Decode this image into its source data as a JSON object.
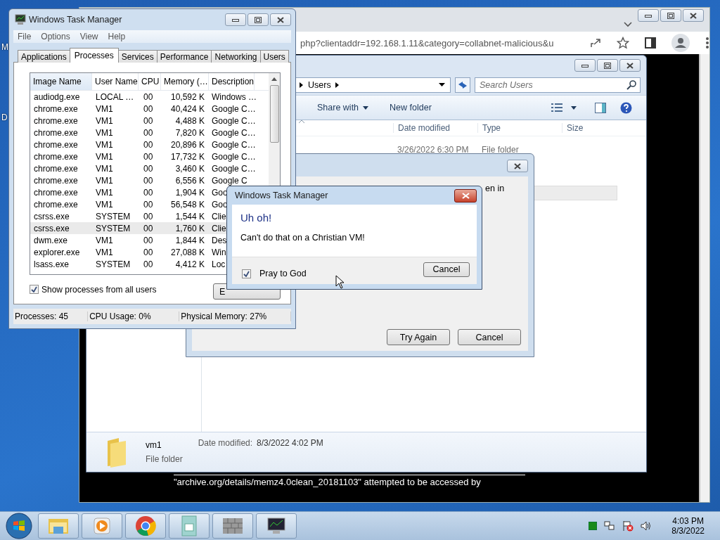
{
  "desktop": {
    "icon_labels": [
      "M",
      "D"
    ]
  },
  "browser": {
    "url": "php?clientaddr=192.168.1.11&category=collabnet-malicious&u",
    "page_text": "\"archive.org/details/memz4.0clean_20181103\" attempted to be accessed by"
  },
  "explorer": {
    "breadcrumb": "Users",
    "search": {
      "placeholder": "Search Users"
    },
    "toolbar": [
      "Share with",
      "New folder"
    ],
    "columns": [
      "Date modified",
      "Type",
      "Size"
    ],
    "rows": [
      {
        "date": "3/26/2022 6:30 PM",
        "type": "File folder"
      }
    ],
    "details": {
      "name": "vm1",
      "type": "File folder",
      "date_label": "Date modified:",
      "date": "8/3/2022 4:02 PM"
    }
  },
  "error_dialog": {
    "text": "en in",
    "buttons": [
      "Try Again",
      "Cancel"
    ]
  },
  "task_manager": {
    "title": "Windows Task Manager",
    "menu": [
      "File",
      "Options",
      "View",
      "Help"
    ],
    "tabs": [
      {
        "label": "Applications",
        "selected": false
      },
      {
        "label": "Processes",
        "selected": true
      },
      {
        "label": "Services",
        "selected": false
      },
      {
        "label": "Performance",
        "selected": false
      },
      {
        "label": "Networking",
        "selected": false
      },
      {
        "label": "Users",
        "selected": false
      }
    ],
    "columns": [
      "Image Name",
      "User Name",
      "CPU",
      "Memory (…",
      "Description"
    ],
    "rows": [
      {
        "cells": [
          "audiodg.exe",
          "LOCAL …",
          "00",
          "10,592 K",
          "Windows …"
        ],
        "selected": false
      },
      {
        "cells": [
          "chrome.exe",
          "VM1",
          "00",
          "40,424 K",
          "Google C…"
        ],
        "selected": false
      },
      {
        "cells": [
          "chrome.exe",
          "VM1",
          "00",
          "4,488 K",
          "Google C…"
        ],
        "selected": false
      },
      {
        "cells": [
          "chrome.exe",
          "VM1",
          "00",
          "7,820 K",
          "Google C…"
        ],
        "selected": false
      },
      {
        "cells": [
          "chrome.exe",
          "VM1",
          "00",
          "20,896 K",
          "Google C…"
        ],
        "selected": false
      },
      {
        "cells": [
          "chrome.exe",
          "VM1",
          "00",
          "17,732 K",
          "Google C…"
        ],
        "selected": false
      },
      {
        "cells": [
          "chrome.exe",
          "VM1",
          "00",
          "3,460 K",
          "Google C…"
        ],
        "selected": false
      },
      {
        "cells": [
          "chrome.exe",
          "VM1",
          "00",
          "6,556 K",
          "Google C"
        ],
        "selected": false
      },
      {
        "cells": [
          "chrome.exe",
          "VM1",
          "00",
          "1,904 K",
          "Goo"
        ],
        "selected": false
      },
      {
        "cells": [
          "chrome.exe",
          "VM1",
          "00",
          "56,548 K",
          "Goo"
        ],
        "selected": false
      },
      {
        "cells": [
          "csrss.exe",
          "SYSTEM",
          "00",
          "1,544 K",
          "Clie"
        ],
        "selected": false
      },
      {
        "cells": [
          "csrss.exe",
          "SYSTEM",
          "00",
          "1,760 K",
          "Clie"
        ],
        "selected": true
      },
      {
        "cells": [
          "dwm.exe",
          "VM1",
          "00",
          "1,844 K",
          "Des"
        ],
        "selected": false
      },
      {
        "cells": [
          "explorer.exe",
          "VM1",
          "00",
          "27,088 K",
          "Win"
        ],
        "selected": false
      },
      {
        "cells": [
          "lsass.exe",
          "SYSTEM",
          "00",
          "4,412 K",
          "Loc"
        ],
        "selected": false
      }
    ],
    "show_all": {
      "label": "Show processes from all users",
      "checked": true
    },
    "end_button": "E",
    "status": [
      "Processes: 45",
      "CPU Usage: 0%",
      "Physical Memory: 27%"
    ]
  },
  "message_box": {
    "title": "Windows Task Manager",
    "heading": "Uh oh!",
    "message": "Can't do that on a Christian VM!",
    "checkbox": {
      "label": "Pray to God",
      "checked": true
    },
    "button": "Cancel"
  },
  "taskbar": {
    "apps": [
      {
        "kind": "folder"
      },
      {
        "kind": "media"
      },
      {
        "kind": "browser"
      },
      {
        "kind": "document"
      },
      {
        "kind": "wall"
      },
      {
        "kind": "monitor"
      }
    ],
    "time": "4:03 PM",
    "date": "8/3/2022"
  }
}
